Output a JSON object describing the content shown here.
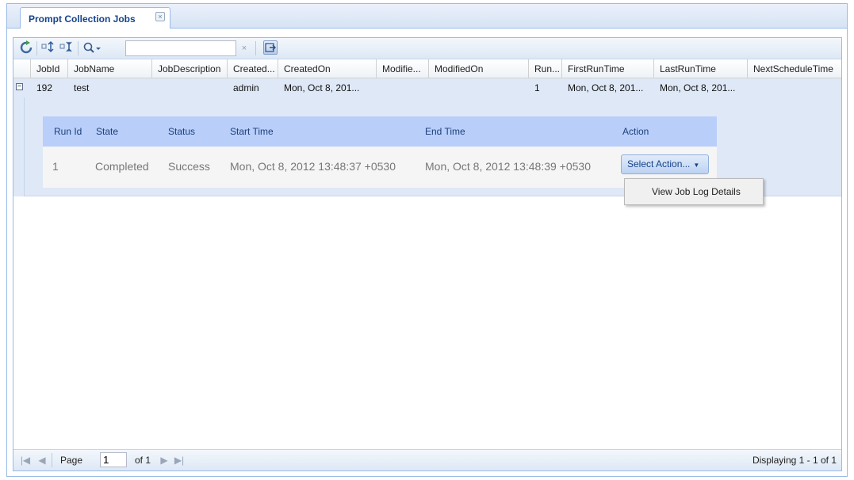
{
  "tab": {
    "title": "Prompt Collection Jobs",
    "close_glyph": "×"
  },
  "toolbar": {
    "search_value": "",
    "search_placeholder": "",
    "clear_glyph": "×",
    "icons": [
      "refresh-icon",
      "expand-all-icon",
      "collapse-all-icon",
      "search-options-icon",
      "export-icon"
    ]
  },
  "grid": {
    "columns": [
      "JobId",
      "JobName",
      "JobDescription",
      "Created...",
      "CreatedOn",
      "Modifie...",
      "ModifiedOn",
      "Run...",
      "FirstRunTime",
      "LastRunTime",
      "NextScheduleTime"
    ],
    "rows": [
      {
        "jobid": "192",
        "jobname": "test",
        "jobdescription": "",
        "createdby": "admin",
        "createdon": "Mon, Oct 8, 201...",
        "modifiedby": "",
        "modifiedon": "",
        "runs": "1",
        "firstruntime": "Mon, Oct 8, 201...",
        "lastruntime": "Mon, Oct 8, 201...",
        "nextscheduletime": ""
      }
    ]
  },
  "details": {
    "columns": [
      "Run Id",
      "State",
      "Status",
      "Start Time",
      "End Time",
      "Action"
    ],
    "rows": [
      {
        "run_id": "1",
        "state": "Completed",
        "status": "Success",
        "start_time": "Mon, Oct 8, 2012 13:48:37 +0530",
        "end_time": "Mon, Oct 8, 2012 13:48:39 +0530",
        "action_label": "Select Action..."
      }
    ]
  },
  "action_menu": {
    "items": [
      "View Job Log Details"
    ]
  },
  "pager": {
    "page_label": "Page",
    "page_value": "1",
    "of_label": "of 1",
    "display_info": "Displaying 1 - 1 of 1"
  },
  "colors": {
    "accent": "#15428b",
    "header_bg": "#dfe8f6",
    "inner_header_bg": "#b9cffa",
    "border": "#99bbe8"
  }
}
